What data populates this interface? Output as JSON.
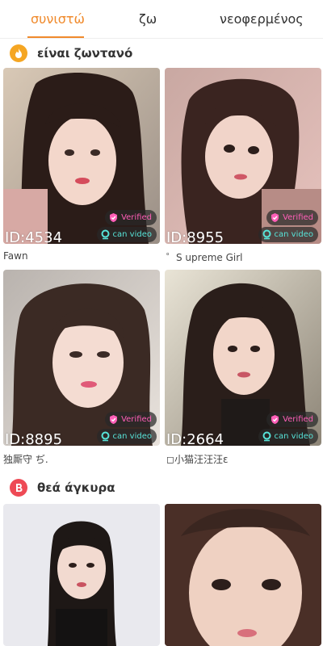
{
  "tabs": [
    {
      "label": "συνιστώ",
      "active": true
    },
    {
      "label": "ζω",
      "active": false
    },
    {
      "label": "νεοφερμένος",
      "active": false
    }
  ],
  "accent_color": "#f08a2c",
  "sections": [
    {
      "title": "είναι ζωντανό",
      "icon": "flame-icon",
      "icon_color": "#f5a623"
    },
    {
      "title": "θεά άγκυρα",
      "icon": "b-logo-icon",
      "icon_color": "#ee4a55"
    }
  ],
  "badges": {
    "verified": "Verified",
    "video": "can video",
    "verified_color": "#ff5fb8",
    "video_color": "#57e3d8"
  },
  "cards": [
    {
      "id": "ID:4534",
      "name": "Fawn"
    },
    {
      "id": "ID:8955",
      "name": "゜S upreme Girl"
    },
    {
      "id": "ID:8895",
      "name": "独厮守 ぢ."
    },
    {
      "id": "ID:2664",
      "name": "◻小猫汪汪汪ε"
    }
  ]
}
